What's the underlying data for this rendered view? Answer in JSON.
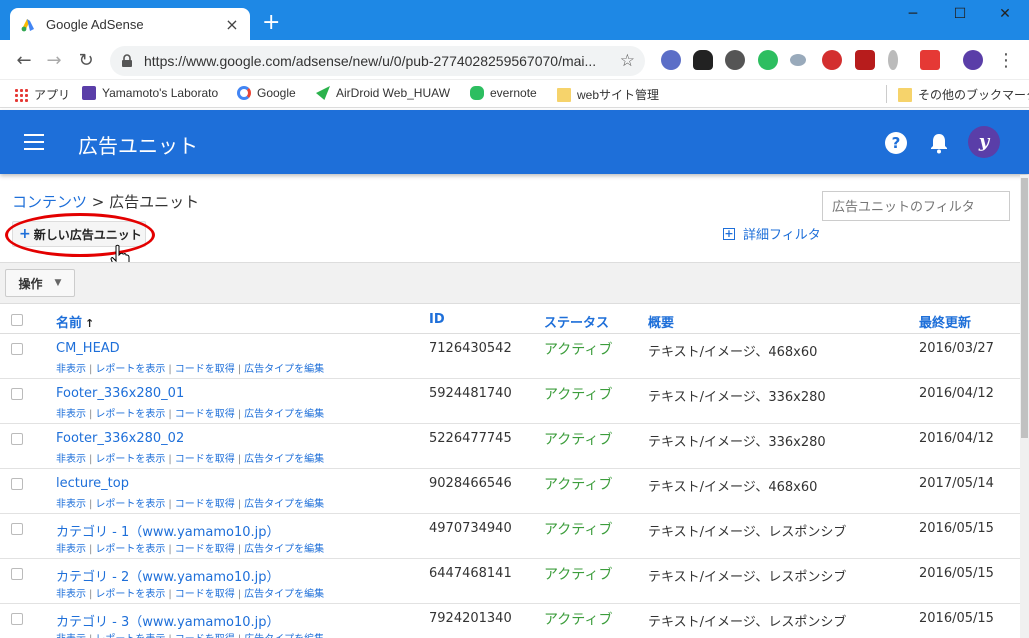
{
  "browser": {
    "tab_title": "Google AdSense",
    "new_tab": "+",
    "url": "https://www.google.com/adsense/new/u/0/pub-2774028259567070/mai...",
    "window_controls": [
      "─",
      "☐",
      "✕"
    ]
  },
  "bookmarks": [
    {
      "label": "アプリ",
      "icon": "apps-grid-icon"
    },
    {
      "label": "Yamamoto's Laborato",
      "icon": "yamamoto-icon"
    },
    {
      "label": "Google",
      "icon": "google-icon"
    },
    {
      "label": "AirDroid Web_HUAW",
      "icon": "airdroid-icon"
    },
    {
      "label": "evernote",
      "icon": "evernote-icon"
    },
    {
      "label": "webサイト管理",
      "icon": "folder-icon"
    },
    {
      "label": "その他のブックマーク",
      "icon": "folder-icon"
    }
  ],
  "appbar": {
    "title": "広告ユニット",
    "help": "?",
    "avatar": "y"
  },
  "breadcrumb": {
    "root": "コンテンツ",
    "sep": " > ",
    "current": "広告ユニット"
  },
  "filter": {
    "placeholder": "広告ユニットのフィルタ"
  },
  "new_button": {
    "plus": "+",
    "label": "新しい広告ユニット"
  },
  "advanced_filter": {
    "plus": "+",
    "label": "詳細フィルタ"
  },
  "operations": {
    "label": "操作",
    "caret": "▼"
  },
  "table": {
    "headers": {
      "name": "名前",
      "sort": "↑",
      "id": "ID",
      "status": "ステータス",
      "summary": "概要",
      "updated": "最終更新"
    },
    "actions": [
      "非表示",
      "レポートを表示",
      "コードを取得",
      "広告タイプを編集"
    ],
    "action_sep": "|",
    "rows": [
      {
        "name": "CM_HEAD",
        "id": "7126430542",
        "status": "アクティブ",
        "summary": "テキスト/イメージ、468x60",
        "updated": "2016/03/27"
      },
      {
        "name": "Footer_336x280_01",
        "id": "5924481740",
        "status": "アクティブ",
        "summary": "テキスト/イメージ、336x280",
        "updated": "2016/04/12"
      },
      {
        "name": "Footer_336x280_02",
        "id": "5226477745",
        "status": "アクティブ",
        "summary": "テキスト/イメージ、336x280",
        "updated": "2016/04/12"
      },
      {
        "name": "lecture_top",
        "id": "9028466546",
        "status": "アクティブ",
        "summary": "テキスト/イメージ、468x60",
        "updated": "2017/05/14"
      },
      {
        "name": "カテゴリ - 1（www.yamamo10.jp）",
        "id": "4970734940",
        "status": "アクティブ",
        "summary": "テキスト/イメージ、レスポンシブ",
        "updated": "2016/05/15"
      },
      {
        "name": "カテゴリ - 2（www.yamamo10.jp）",
        "id": "6447468141",
        "status": "アクティブ",
        "summary": "テキスト/イメージ、レスポンシブ",
        "updated": "2016/05/15"
      },
      {
        "name": "カテゴリ - 3（www.yamamo10.jp）",
        "id": "7924201340",
        "status": "アクティブ",
        "summary": "テキスト/イメージ、レスポンシブ",
        "updated": "2016/05/15"
      }
    ]
  },
  "colors": {
    "appbar": "#1e6fd9",
    "tabstrip": "#1e88e5",
    "link": "#1e6fd9",
    "active_status": "#3c9d3c",
    "highlight_ring": "#e30000"
  }
}
